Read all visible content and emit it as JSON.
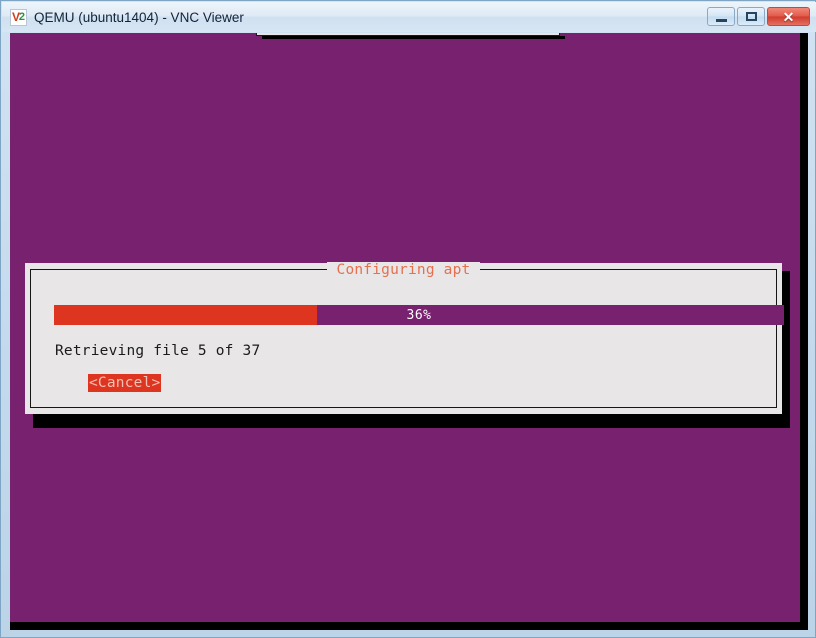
{
  "window": {
    "title": "QEMU (ubuntu1404) - VNC Viewer",
    "icon": "vnc-viewer-icon",
    "icon_letter_v": "V",
    "icon_letter_2": "2",
    "controls": {
      "minimize_label": "",
      "maximize_label": "",
      "close_label": "✕",
      "minimize_name": "minimize-button",
      "maximize_name": "restore-button",
      "close_name": "close-button"
    }
  },
  "desktop": {
    "background_color": "#77216f"
  },
  "dialog": {
    "title": "Configuring apt",
    "title_color": "#e4704f",
    "background_color": "#e8e6e6",
    "status_text": "Retrieving file 5 of 37",
    "cancel_label": "<Cancel>",
    "cancel_bg_color": "#dd3520",
    "cancel_text_color": "#f4c0b4",
    "progress": {
      "percent_label": "36%",
      "percent_value": 36,
      "fill_color": "#dd3520",
      "track_color": "#77216f",
      "text_color": "#ffffff"
    }
  }
}
